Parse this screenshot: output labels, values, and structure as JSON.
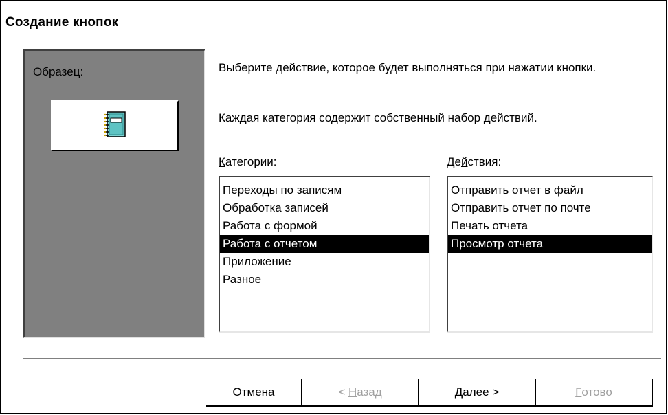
{
  "window": {
    "title": "Создание кнопок"
  },
  "sample": {
    "label": "Образец:",
    "icon": "notebook-icon"
  },
  "description": {
    "line1": "Выберите действие, которое будет выполняться при нажатии кнопки.",
    "line2": "Каждая категория содержит собственный набор действий."
  },
  "categories": {
    "label_accel": "К",
    "label_rest": "атегории:",
    "items": [
      "Переходы по записям",
      "Обработка записей",
      "Работа с формой",
      "Работа с отчетом",
      "Приложение",
      "Разное"
    ],
    "selected": "Работа с отчетом"
  },
  "actions": {
    "label_pre": "Де",
    "label_accel": "й",
    "label_post": "ствия:",
    "items": [
      "Отправить отчет в файл",
      "Отправить отчет по почте",
      "Печать отчета",
      "Просмотр отчета"
    ],
    "selected": "Просмотр отчета"
  },
  "buttons": {
    "cancel": "Отмена",
    "back_pre": "< ",
    "back_accel": "Н",
    "back_post": "азад",
    "next_accel": "Д",
    "next_post": "алее >",
    "finish_accel": "Г",
    "finish_post": "отово"
  },
  "colors": {
    "sample_panel_bg": "#808080",
    "selection_bg": "#000000",
    "selection_fg": "#ffffff",
    "disabled_text": "#a0a0a0"
  }
}
